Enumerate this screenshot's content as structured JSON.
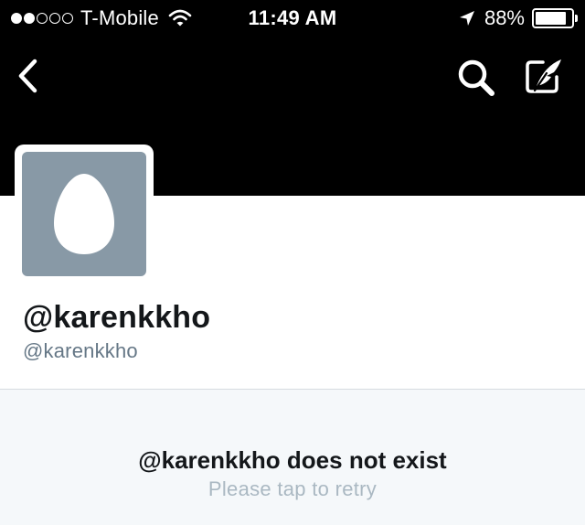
{
  "status_bar": {
    "carrier": "T-Mobile",
    "signal_bars_filled": 2,
    "signal_bars_total": 5,
    "time": "11:49 AM",
    "battery_percent": "88%",
    "battery_level": 0.88
  },
  "nav": {
    "back_icon": "chevron-left-icon",
    "search_icon": "search-icon",
    "compose_icon": "compose-tweet-icon"
  },
  "profile": {
    "display_name": "@karenkkho",
    "handle": "@karenkkho",
    "avatar_icon": "default-egg-avatar"
  },
  "error": {
    "title": "@karenkkho does not exist",
    "subtitle": "Please tap to retry"
  },
  "colors": {
    "header_bg": "#000000",
    "avatar_bg": "#8899a6",
    "page_bg": "#f5f8fa",
    "secondary_text": "#657786",
    "retry_text": "#aab8c2"
  }
}
